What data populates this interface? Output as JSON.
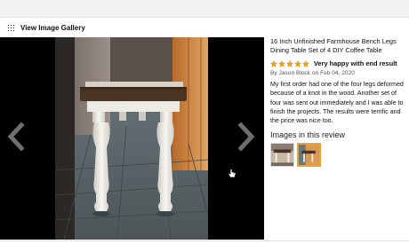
{
  "gallery": {
    "title": "View Image Gallery"
  },
  "viewer": {
    "prev_icon": "chevron-left-icon",
    "next_icon": "chevron-right-icon",
    "cursor_icon": "hand-pointer-icon"
  },
  "review": {
    "product_title": "16 Inch Unfinished Farmhouse Bench Legs Dining Table Set of 4 DIY Coffee Table",
    "stars": 5,
    "star_color": "#f0a11b",
    "headline": "Very happy with end result",
    "byline": "By Jason Block on Feb 04, 2020",
    "body": "My first order had one of the four legs deformed because of a knot in the wood. Another set of four was sent out immediately and I was able to finish the projects. The results were terrific and the price was nice too.",
    "images_heading": "Images in this review",
    "thumbnails": [
      {
        "name": "thumbnail-1",
        "selected": false
      },
      {
        "name": "thumbnail-2",
        "selected": true
      }
    ],
    "selected_border_color": "#e8a23a"
  }
}
